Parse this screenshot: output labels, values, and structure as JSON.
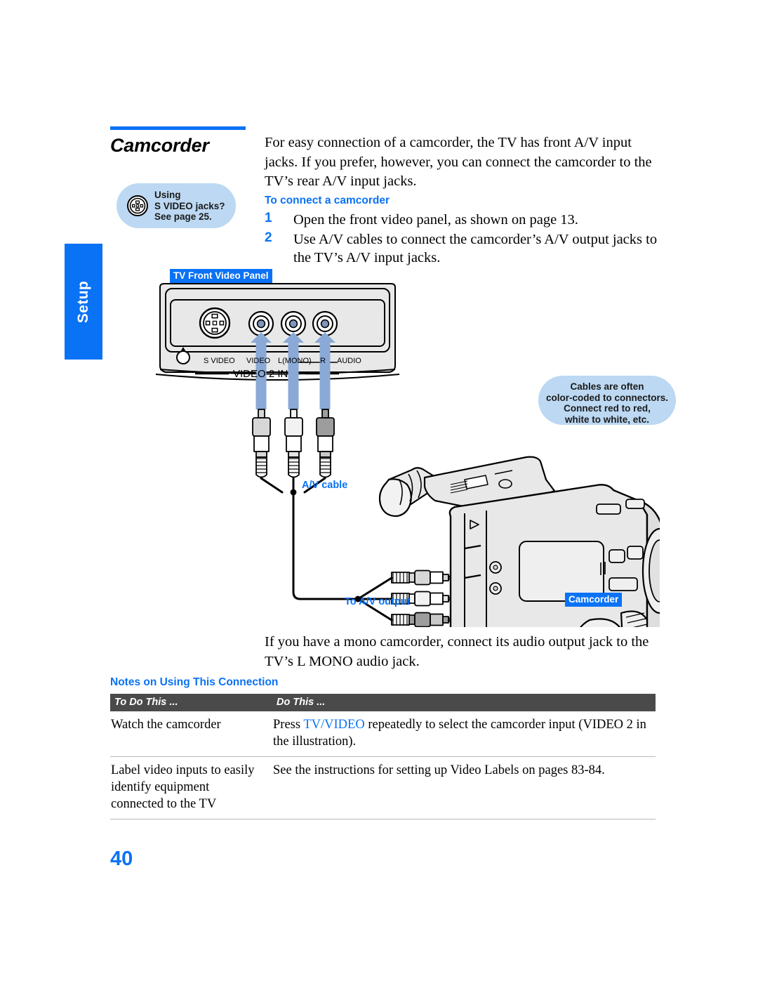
{
  "side_tab": {
    "label": "Setup"
  },
  "heading": {
    "title": "Camcorder"
  },
  "tip_bubble": {
    "icon": "s-video-jack-icon",
    "line1": "Using",
    "line2": "S VIDEO jacks?",
    "line3": "See page 25."
  },
  "intro": "For easy connection of a camcorder, the TV has front A/V input jacks. If you prefer, however, you can connect the camcorder to the TV’s rear A/V input jacks.",
  "procedure": {
    "subhead": "To connect a camcorder",
    "steps": [
      {
        "number": "1",
        "text": "Open the front video panel, as shown on page 13."
      },
      {
        "number": "2",
        "text": "Use A/V cables to connect the camcorder’s A/V output jacks to the TV’s A/V input jacks."
      }
    ]
  },
  "diagram": {
    "panel_label": "TV Front Video Panel",
    "jack_labels": [
      "S VIDEO",
      "VIDEO",
      "L(MONO)",
      "R",
      "AUDIO"
    ],
    "panel_caption": "VIDEO 2 IN",
    "cable_label": "A/V cable",
    "output_label": "To A/V output",
    "camcorder_label": "Camcorder",
    "color_note": {
      "line1": "Cables are often",
      "line2": "color-coded to connectors.",
      "line3": "Connect red to red,",
      "line4": "white to white, etc."
    }
  },
  "mono_note": "If you have a mono camcorder, connect its audio output jack to the TV’s L MONO audio jack.",
  "notes": {
    "title": "Notes on Using This Connection",
    "columns": [
      "To Do This ...",
      "Do This ..."
    ],
    "rows": [
      {
        "do_this": "Watch the camcorder",
        "action_pre": "Press ",
        "action_hl": "TV/VIDEO",
        "action_post": " repeatedly to select the camcorder input (VIDEO 2 in the illustration)."
      },
      {
        "do_this": "Label video inputs to easily identify equipment connected to the TV",
        "action_pre": "See the instructions for setting up Video Labels on pages 83-84.",
        "action_hl": "",
        "action_post": ""
      }
    ]
  },
  "page_number": "40",
  "colors": {
    "accent": "#0a72f5",
    "bubble": "#bcd8f2",
    "table_header": "#4a4a4a",
    "arrow": "#8aa9d6"
  }
}
